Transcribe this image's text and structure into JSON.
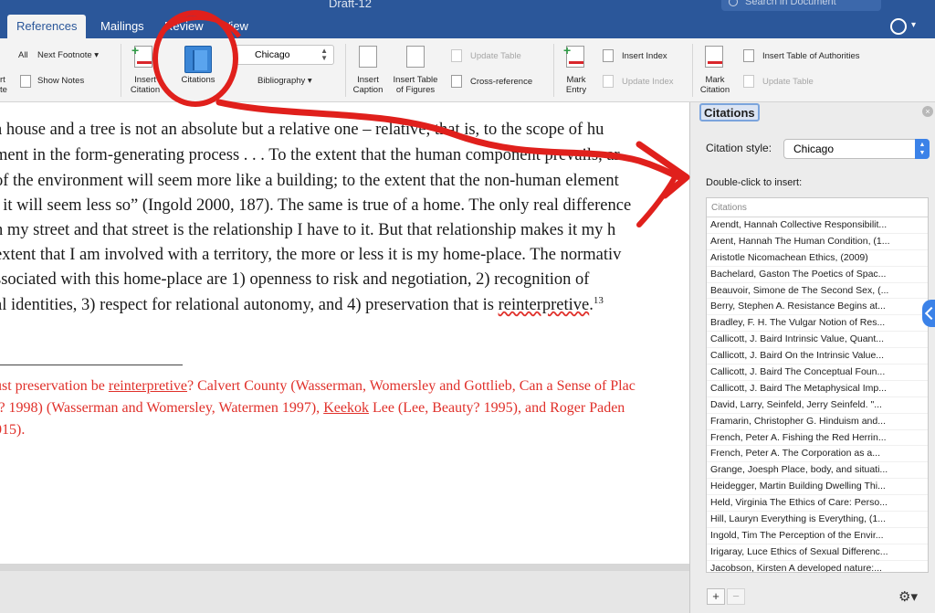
{
  "window": {
    "title": "Draft-12",
    "search_placeholder": "Search in Document"
  },
  "tabs": [
    {
      "label": "References",
      "active": true
    },
    {
      "label": "Mailings"
    },
    {
      "label": "Review"
    },
    {
      "label": "View"
    }
  ],
  "ribbon": {
    "insert_footnote": "Next Footnote",
    "all_footnotes": "All",
    "show_notes": "Show Notes",
    "insert_endnote_1": "rt",
    "insert_endnote_2": "te",
    "insert_citation_1": "Insert",
    "insert_citation_2": "Citation",
    "citations": "Citations",
    "citation_style": "Chicago",
    "bibliography": "Bibliography",
    "insert_caption_1": "Insert",
    "insert_caption_2": "Caption",
    "insert_table_figures_1": "Insert Table",
    "insert_table_figures_2": "of Figures",
    "update_table": "Update Table",
    "cross_reference": "Cross-reference",
    "mark_entry_1": "Mark",
    "mark_entry_2": "Entry",
    "insert_index": "Insert Index",
    "update_index": "Update Index",
    "mark_citation_1": "Mark",
    "mark_citation_2": "Citation",
    "insert_toa": "Insert Table of Authorities",
    "update_table_2": "Update Table"
  },
  "document": {
    "lines": [
      {
        "pre": "a house and a tree is not an absolute but a relative one – relative, that is, to the scope of hu"
      },
      {
        "pre": "ment in the form-generating process . . . To the extent that the human component prevails, ar"
      },
      {
        "pre": "of the environment will seem more like a building; to the extent that the non-human element"
      },
      {
        "pre": ", it will seem less so” (Ingold 2000, 187). The same is true of a home. The only real difference"
      },
      {
        "pre": "n my street and that street is the relationship I have to it. But that relationship makes it my h"
      },
      {
        "pre": "extent that I am involved with a territory, the more or less it is my home-place. The normativ"
      },
      {
        "pre": "ssociated with this home-place are 1) openness to risk and negotiation, 2) recognition of"
      },
      {
        "pre": "al identities, 3) respect for relational autonomy, and 4) preservation that is ",
        "squig": "reinterpretive",
        "post": ".",
        "sup": "13"
      }
    ],
    "footnotes": [
      {
        "pre": "ust preservation be ",
        "u": "reinterpretive",
        "post": "? Calvert County (Wasserman, Womersley and Gottlieb, Can a Sense of Plac"
      },
      {
        "pre": "l? 1998) (Wasserman and Womersley, Watermen 1997), ",
        "u": "Keekok",
        "post": " Lee (Lee, Beauty? 1995), and Roger Paden "
      },
      {
        "pre": "015)."
      }
    ]
  },
  "pane": {
    "title": "Citations",
    "citation_style_label": "Citation style:",
    "citation_style_value": "Chicago",
    "double_click_label": "Double-click to insert:",
    "list_header": "Citations",
    "citations": [
      "Arendt, Hannah Collective Responsibilit...",
      "Arent, Hannah The Human Condition, (1...",
      "Aristotle Nicomachean Ethics, (2009)",
      "Bachelard, Gaston The Poetics of Spac...",
      "Beauvoir, Simone de The Second Sex, (...",
      "Berry, Stephen A. Resistance Begins at...",
      "Bradley, F. H. The Vulgar Notion of Res...",
      "Callicott, J. Baird Intrinsic Value, Quant...",
      "Callicott, J. Baird On the Intrinsic Value...",
      "Callicott, J. Baird The Conceptual Foun...",
      "Callicott, J. Baird The Metaphysical Imp...",
      "David, Larry,  Seinfeld, Jerry Seinfeld. \"...",
      "Framarin, Christopher G. Hinduism and...",
      "French, Peter A. Fishing the Red Herrin...",
      "French, Peter A. The Corporation as a...",
      "Grange, Joesph Place, body, and situati...",
      "Heidegger, Martin Building Dwelling Thi...",
      "Held, Virginia The Ethics of Care: Perso...",
      "Hill, Lauryn Everything is Everything, (1...",
      "Ingold, Tim The Perception of the Envir...",
      "Irigaray, Luce Ethics of Sexual Differenc...",
      "Jacobson, Kirsten A developed nature:..."
    ],
    "add_label": "+",
    "remove_label": "−"
  },
  "colors": {
    "title_bar": "#2b579a",
    "annotation": "#e0201c",
    "footnote_text": "#e0302a",
    "accent": "#3b82e8"
  }
}
